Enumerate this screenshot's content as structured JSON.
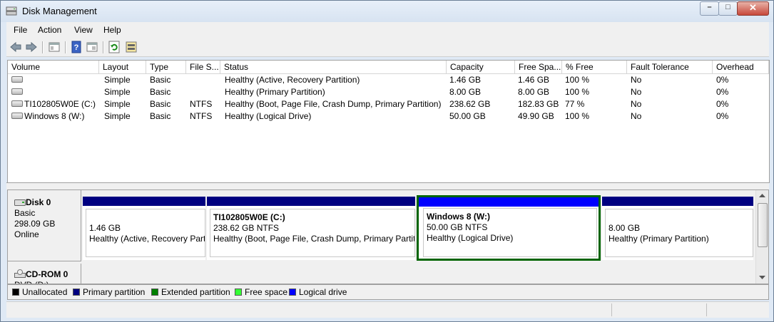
{
  "window": {
    "title": "Disk Management"
  },
  "menu": [
    "File",
    "Action",
    "View",
    "Help"
  ],
  "columns": [
    "Volume",
    "Layout",
    "Type",
    "File S...",
    "Status",
    "Capacity",
    "Free Spa...",
    "% Free",
    "Fault Tolerance",
    "Overhead"
  ],
  "volumes": [
    [
      "",
      "Simple",
      "Basic",
      "",
      "Healthy (Active, Recovery Partition)",
      "1.46 GB",
      "1.46 GB",
      "100 %",
      "No",
      "0%"
    ],
    [
      "",
      "Simple",
      "Basic",
      "",
      "Healthy (Primary Partition)",
      "8.00 GB",
      "8.00 GB",
      "100 %",
      "No",
      "0%"
    ],
    [
      "TI102805W0E (C:)",
      "Simple",
      "Basic",
      "NTFS",
      "Healthy (Boot, Page File, Crash Dump, Primary Partition)",
      "238.62 GB",
      "182.83 GB",
      "77 %",
      "No",
      "0%"
    ],
    [
      "Windows 8 (W:)",
      "Simple",
      "Basic",
      "NTFS",
      "Healthy (Logical Drive)",
      "50.00 GB",
      "49.90 GB",
      "100 %",
      "No",
      "0%"
    ]
  ],
  "disk0": {
    "name": "Disk 0",
    "type": "Basic",
    "size": "298.09 GB",
    "state": "Online",
    "partitions": [
      {
        "name": "",
        "size": "1.46 GB",
        "status": "Healthy (Active, Recovery Part"
      },
      {
        "name": "TI102805W0E  (C:)",
        "size": "238.62 GB NTFS",
        "status": "Healthy (Boot, Page File, Crash Dump, Primary Partiti"
      },
      {
        "name": "Windows 8  (W:)",
        "size": "50.00 GB NTFS",
        "status": "Healthy (Logical Drive)"
      },
      {
        "name": "",
        "size": "8.00 GB",
        "status": "Healthy (Primary Partition)"
      }
    ]
  },
  "cdrom0": {
    "name": "CD-ROM 0",
    "type": "DVD (D:)"
  },
  "legend": [
    {
      "label": "Unallocated",
      "color": "#000000"
    },
    {
      "label": "Primary partition",
      "color": "#000080"
    },
    {
      "label": "Extended partition",
      "color": "#008000"
    },
    {
      "label": "Free space",
      "color": "#33ff33"
    },
    {
      "label": "Logical drive",
      "color": "#0000ff"
    }
  ]
}
